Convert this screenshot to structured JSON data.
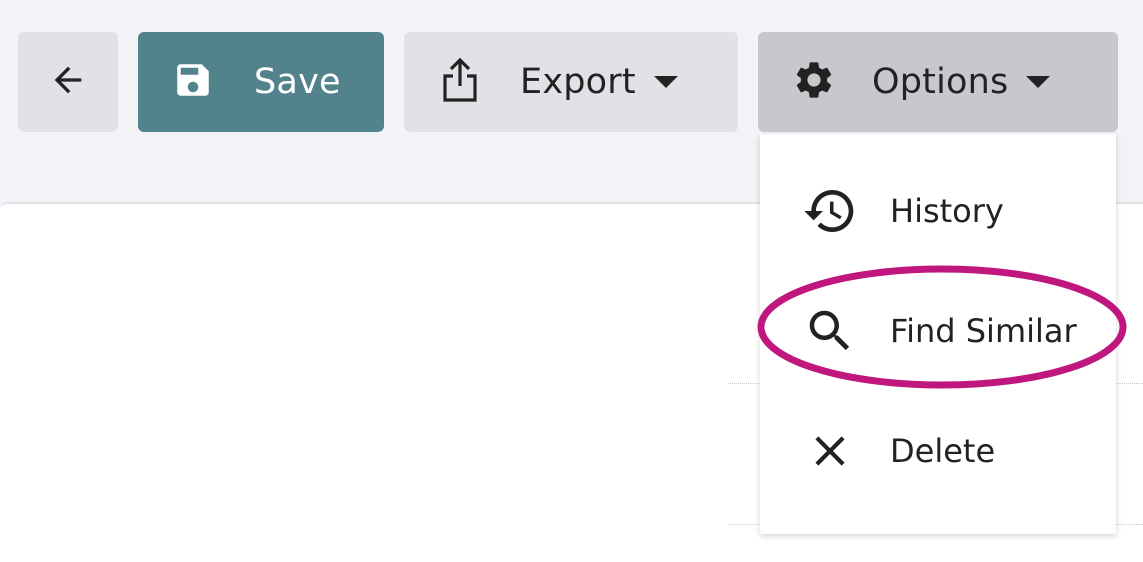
{
  "toolbar": {
    "back": {
      "icon": "arrow-left-icon"
    },
    "save": {
      "label": "Save",
      "icon": "floppy-disk-icon",
      "color": "#52838c"
    },
    "export": {
      "label": "Export",
      "icon": "share-upload-icon"
    },
    "options": {
      "label": "Options",
      "icon": "gear-icon",
      "expanded": true
    }
  },
  "options_menu": {
    "items": [
      {
        "label": "History",
        "icon": "history-icon"
      },
      {
        "label": "Find Similar",
        "icon": "search-icon",
        "highlighted": true
      },
      {
        "label": "Delete",
        "icon": "close-icon"
      }
    ]
  },
  "annotation": {
    "highlight_color": "#c0177f"
  }
}
